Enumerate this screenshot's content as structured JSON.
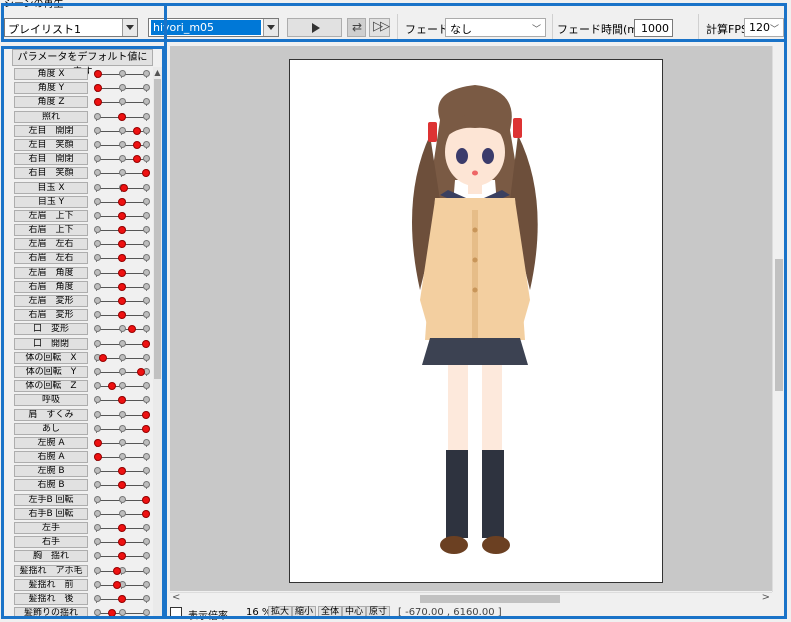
{
  "group_title": "シーンの再生",
  "playlist": {
    "value": "プレイリスト1"
  },
  "model": {
    "value": "hiyori_m05"
  },
  "fade": {
    "label": "フェード：",
    "value": "なし"
  },
  "fade_time": {
    "label": "フェード時間(ms)：",
    "value": "1000"
  },
  "fps": {
    "label": "計算FPS",
    "value": "120"
  },
  "reset_button": "パラメータをデフォルト値に戻す",
  "params": [
    {
      "name": "角度 X",
      "value": 0.0
    },
    {
      "name": "角度 Y",
      "value": 0.0
    },
    {
      "name": "角度 Z",
      "value": 0.0
    },
    {
      "name": "照れ",
      "value": 0.5
    },
    {
      "name": "左目　開閉",
      "value": 0.82
    },
    {
      "name": "左目　笑顔",
      "value": 0.82
    },
    {
      "name": "右目　開閉",
      "value": 0.82
    },
    {
      "name": "右目　笑顔",
      "value": 1.0
    },
    {
      "name": "目玉 X",
      "value": 0.55
    },
    {
      "name": "目玉 Y",
      "value": 0.5
    },
    {
      "name": "左眉　上下",
      "value": 0.5
    },
    {
      "name": "右眉　上下",
      "value": 0.5
    },
    {
      "name": "左眉　左右",
      "value": 0.5
    },
    {
      "name": "右眉　左右",
      "value": 0.5
    },
    {
      "name": "左眉　角度",
      "value": 0.5
    },
    {
      "name": "右眉　角度",
      "value": 0.5
    },
    {
      "name": "左眉　変形",
      "value": 0.5
    },
    {
      "name": "右眉　変形",
      "value": 0.5
    },
    {
      "name": "口　変形",
      "value": 0.7
    },
    {
      "name": "口　開閉",
      "value": 1.0
    },
    {
      "name": "体の回転　X",
      "value": 0.1
    },
    {
      "name": "体の回転　Y",
      "value": 0.9
    },
    {
      "name": "体の回転　Z",
      "value": 0.3
    },
    {
      "name": "呼吸",
      "value": 0.5
    },
    {
      "name": "肩　すくみ",
      "value": 1.0
    },
    {
      "name": "あし",
      "value": 1.0
    },
    {
      "name": "左腕 A",
      "value": 0.0
    },
    {
      "name": "右腕 A",
      "value": 0.0
    },
    {
      "name": "左腕 B",
      "value": 0.5
    },
    {
      "name": "右腕 B",
      "value": 0.5
    },
    {
      "name": "左手B 回転",
      "value": 1.0
    },
    {
      "name": "右手B 回転",
      "value": 1.0
    },
    {
      "name": "左手",
      "value": 0.5
    },
    {
      "name": "右手",
      "value": 0.5
    },
    {
      "name": "胸　揺れ",
      "value": 0.5
    },
    {
      "name": "髪揺れ　アホ毛",
      "value": 0.4
    },
    {
      "name": "髪揺れ　前",
      "value": 0.4
    },
    {
      "name": "髪揺れ　後",
      "value": 0.5
    },
    {
      "name": "髪飾りの揺れ",
      "value": 0.3
    }
  ],
  "bottom": {
    "scale_label": "表示倍率",
    "scale_value": "16 %",
    "zoom_in": "拡大",
    "zoom_out": "縮小",
    "fit_all": "全体",
    "center": "中心",
    "actual": "原寸",
    "coords": "[ -670.00 , 6160.00 ]"
  }
}
